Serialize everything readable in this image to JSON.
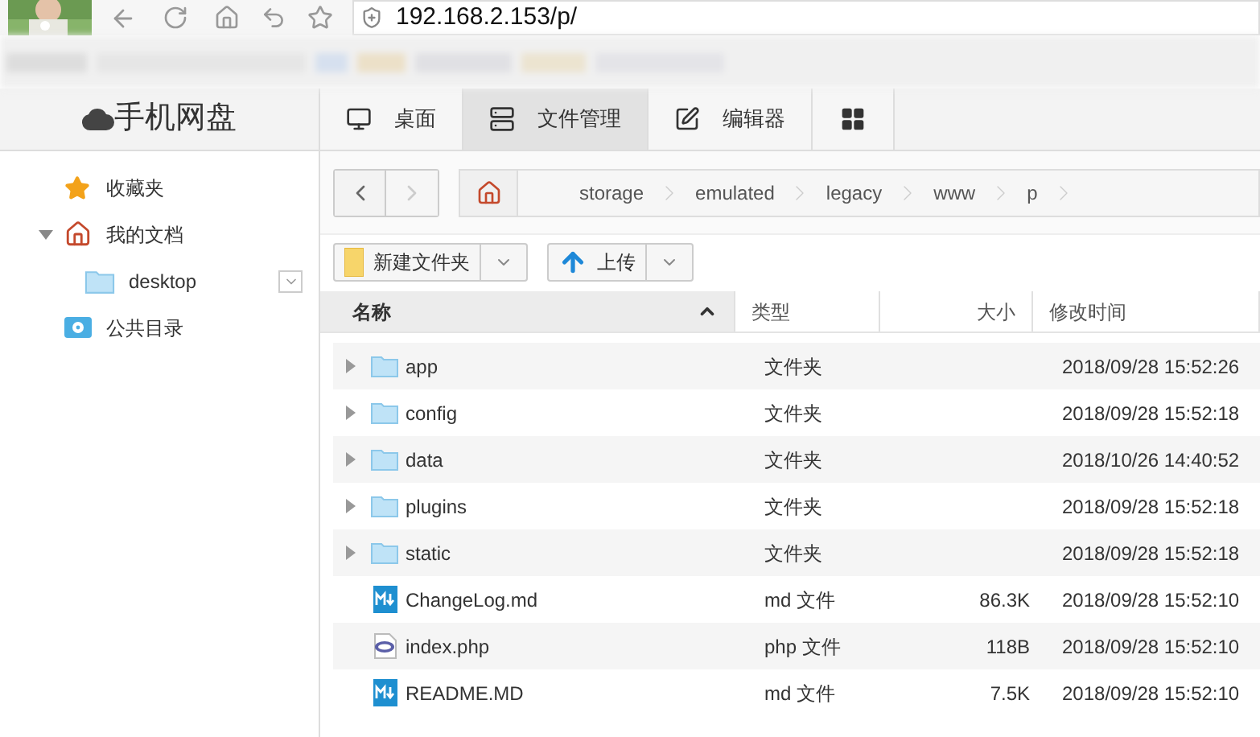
{
  "browser": {
    "url": "192.168.2.153/p/"
  },
  "app": {
    "title": "手机网盘"
  },
  "nav_tabs": [
    {
      "kind": "desktop",
      "label": "桌面",
      "selected": false
    },
    {
      "kind": "files",
      "label": "文件管理",
      "selected": true
    },
    {
      "kind": "editor",
      "label": "编辑器",
      "selected": false
    },
    {
      "kind": "apps",
      "selected": false
    }
  ],
  "sidebar": {
    "items": [
      {
        "kind": "star",
        "label": "收藏夹"
      },
      {
        "kind": "home",
        "label": "我的文档",
        "expanded": true,
        "children": [
          {
            "kind": "folder",
            "label": "desktop"
          }
        ]
      },
      {
        "kind": "public",
        "label": "公共目录"
      }
    ]
  },
  "breadcrumb": [
    "storage",
    "emulated",
    "legacy",
    "www",
    "p"
  ],
  "toolbar": [
    {
      "kind": "new-folder",
      "label": "新建文件夹"
    },
    {
      "kind": "upload",
      "label": "上传"
    }
  ],
  "table": {
    "columns": [
      {
        "label": "名称",
        "sorted": true
      },
      {
        "label": "类型",
        "sorted": false
      },
      {
        "label": "大小",
        "sorted": false
      },
      {
        "label": "修改时间",
        "sorted": false
      }
    ],
    "rows": [
      {
        "kind": "folder",
        "name": "app",
        "type": "文件夹",
        "modified": "2018/09/28 15:52:26"
      },
      {
        "kind": "folder",
        "name": "config",
        "type": "文件夹",
        "modified": "2018/09/28 15:52:18"
      },
      {
        "kind": "folder",
        "name": "data",
        "type": "文件夹",
        "modified": "2018/10/26 14:40:52"
      },
      {
        "kind": "folder",
        "name": "plugins",
        "type": "文件夹",
        "modified": "2018/09/28 15:52:18"
      },
      {
        "kind": "folder",
        "name": "static",
        "type": "文件夹",
        "modified": "2018/09/28 15:52:18"
      },
      {
        "kind": "md",
        "name": "ChangeLog.md",
        "type": "md 文件",
        "size": "86.3K",
        "modified": "2018/09/28 15:52:10"
      },
      {
        "kind": "php",
        "name": "index.php",
        "type": "php 文件",
        "size": "118B",
        "modified": "2018/09/28 15:52:10"
      },
      {
        "kind": "md",
        "name": "README.MD",
        "type": "md 文件",
        "size": "7.5K",
        "modified": "2018/09/28 15:52:10"
      }
    ]
  }
}
